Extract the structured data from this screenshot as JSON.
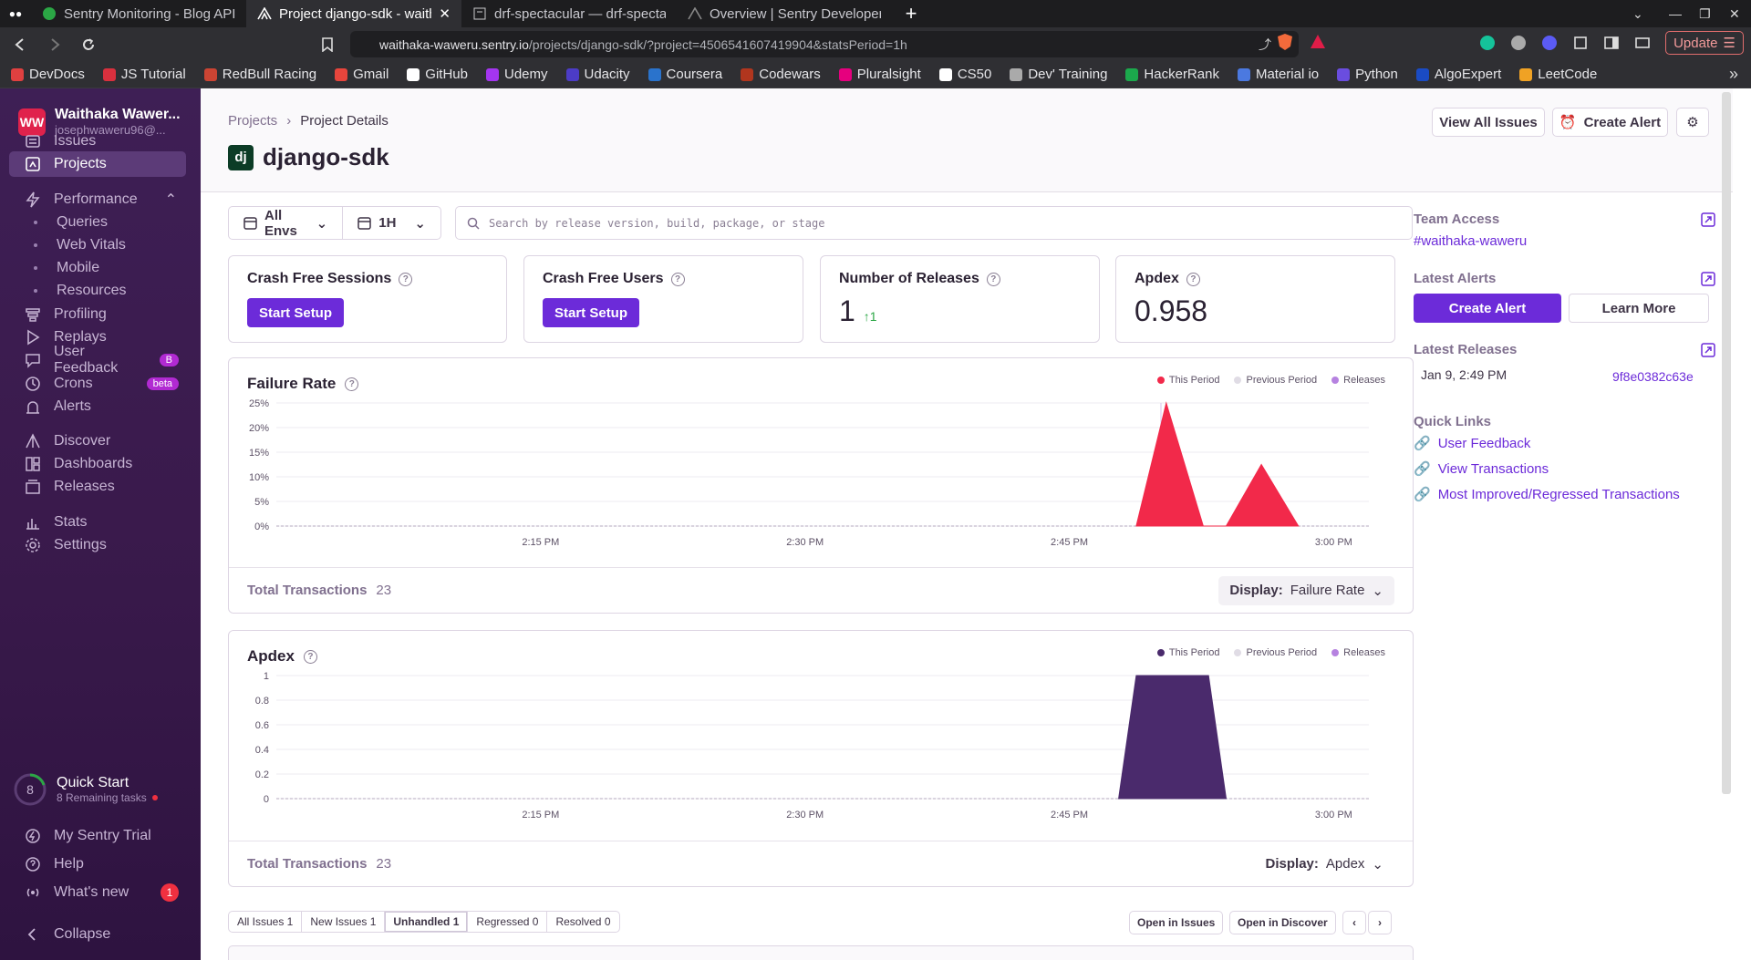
{
  "browser": {
    "tabs": [
      {
        "title": "Sentry Monitoring - Blog API",
        "active": false
      },
      {
        "title": "Project django-sdk - waithaka-waweru",
        "active": true
      },
      {
        "title": "drf-spectacular — drf-spectacular",
        "active": false
      },
      {
        "title": "Overview | Sentry Developer Docs",
        "active": false
      }
    ],
    "url_host": "waithaka-waweru.sentry.io",
    "url_path": "/projects/django-sdk/?project=4506541607419904&statsPeriod=1h",
    "update_label": "Update",
    "bookmarks": [
      "DevDocs",
      "JS Tutorial",
      "RedBull Racing",
      "Gmail",
      "GitHub",
      "Udemy",
      "Udacity",
      "Coursera",
      "Codewars",
      "Pluralsight",
      "CS50",
      "Dev' Training",
      "HackerRank",
      "Material io",
      "Python",
      "AlgoExpert",
      "LeetCode"
    ],
    "bookmark_colors": [
      "#e04040",
      "#d9303e",
      "#c43",
      "#e8453c",
      "#ffffff",
      "#a435f0",
      "#4c3cc6",
      "#2a73cc",
      "#b1361e",
      "#e6007e",
      "#fff",
      "#aaa",
      "#1ba94c",
      "#4b79e0",
      "#6a4ddf",
      "#1a4bc4",
      "#f0a224"
    ]
  },
  "sidebar": {
    "org_initials": "WW",
    "org_name": "Waithaka Wawer...",
    "org_email": "josephwaweru96@...",
    "items": [
      {
        "label": "Issues",
        "icon": "issues-icon"
      },
      {
        "label": "Projects",
        "icon": "projects-icon",
        "active": true
      },
      {
        "label": "Performance",
        "icon": "performance-icon"
      },
      {
        "label": "Queries",
        "sub": true
      },
      {
        "label": "Web Vitals",
        "sub": true
      },
      {
        "label": "Mobile",
        "sub": true
      },
      {
        "label": "Resources",
        "sub": true
      },
      {
        "label": "Profiling",
        "icon": "profiling-icon"
      },
      {
        "label": "Replays",
        "icon": "replays-icon"
      },
      {
        "label": "User Feedback",
        "icon": "user-feedback-icon",
        "badge": "B"
      },
      {
        "label": "Crons",
        "icon": "crons-icon",
        "badge": "beta"
      },
      {
        "label": "Alerts",
        "icon": "alerts-icon"
      },
      {
        "label": "Discover",
        "icon": "discover-icon"
      },
      {
        "label": "Dashboards",
        "icon": "dashboards-icon"
      },
      {
        "label": "Releases",
        "icon": "releases-icon"
      },
      {
        "label": "Stats",
        "icon": "stats-icon"
      },
      {
        "label": "Settings",
        "icon": "settings-icon"
      }
    ],
    "quickstart": {
      "count": "8",
      "title": "Quick Start",
      "subtitle": "8 Remaining tasks"
    },
    "footer": [
      {
        "label": "My Sentry Trial",
        "icon": "trial-icon"
      },
      {
        "label": "Help",
        "icon": "help-icon"
      },
      {
        "label": "What's new",
        "icon": "broadcast-icon",
        "badge": "1"
      },
      {
        "label": "Collapse",
        "icon": "collapse-icon"
      }
    ]
  },
  "header": {
    "breadcrumb_root": "Projects",
    "breadcrumb_current": "Project Details",
    "project_logo": "dj",
    "project_name": "django-sdk",
    "view_all_issues": "View All Issues",
    "create_alert": "Create Alert"
  },
  "filters": {
    "environment": "All Envs",
    "period": "1H",
    "search_placeholder": "Search by release version, build, package, or stage"
  },
  "cards": {
    "crash_free_sessions": {
      "title": "Crash Free Sessions",
      "button": "Start Setup"
    },
    "crash_free_users": {
      "title": "Crash Free Users",
      "button": "Start Setup"
    },
    "number_of_releases": {
      "title": "Number of Releases",
      "value": "1",
      "trend": "↑1"
    },
    "apdex": {
      "title": "Apdex",
      "value": "0.958"
    }
  },
  "legend": {
    "this_period": "This Period",
    "previous_period": "Previous Period",
    "releases": "Releases"
  },
  "failure_chart": {
    "title": "Failure Rate",
    "footer_label": "Total Transactions",
    "footer_value": "23",
    "display_label": "Display:",
    "display_value": "Failure Rate"
  },
  "apdex_chart": {
    "title": "Apdex",
    "footer_label": "Total Transactions",
    "footer_value": "23",
    "display_label": "Display:",
    "display_value": "Apdex"
  },
  "chart_data": [
    {
      "type": "area",
      "title": "Failure Rate",
      "x_ticks": [
        "2:15 PM",
        "2:30 PM",
        "2:45 PM",
        "3:00 PM"
      ],
      "y_ticks": [
        "25%",
        "20%",
        "15%",
        "10%",
        "5%",
        "0%"
      ],
      "ylim": [
        0,
        25
      ],
      "x_unit": "minutes after 2:00 PM",
      "xlim": [
        0,
        62
      ],
      "series": [
        {
          "name": "This Period",
          "color": "#f2294a",
          "points": [
            [
              48.8,
              0
            ],
            [
              50.5,
              25
            ],
            [
              52.6,
              0
            ],
            [
              53.9,
              0
            ],
            [
              55.9,
              12.5
            ],
            [
              58,
              0
            ]
          ]
        }
      ],
      "release_x": 50.2
    },
    {
      "type": "area",
      "title": "Apdex",
      "x_ticks": [
        "2:15 PM",
        "2:30 PM",
        "2:45 PM",
        "3:00 PM"
      ],
      "y_ticks": [
        "1",
        "0.8",
        "0.6",
        "0.4",
        "0.2",
        "0"
      ],
      "ylim": [
        0,
        1
      ],
      "x_unit": "minutes after 2:00 PM",
      "xlim": [
        0,
        62
      ],
      "series": [
        {
          "name": "This Period",
          "color": "#4a2a6c",
          "points": [
            [
              47.8,
              0
            ],
            [
              48.8,
              1
            ],
            [
              52.9,
              1
            ],
            [
              53.9,
              0
            ]
          ]
        }
      ]
    }
  ],
  "right": {
    "team_access_title": "Team Access",
    "team_access_value": "#waithaka-waweru",
    "latest_alerts_title": "Latest Alerts",
    "create_alert": "Create Alert",
    "learn_more": "Learn More",
    "latest_releases_title": "Latest Releases",
    "release_date": "Jan 9, 2:49 PM",
    "release_version": "9f8e0382c63e",
    "quick_links_title": "Quick Links",
    "quick_links": [
      "User Feedback",
      "View Transactions",
      "Most Improved/Regressed Transactions"
    ]
  },
  "issues": {
    "tabs": [
      "All Issues 1",
      "New Issues 1",
      "Unhandled 1",
      "Regressed 0",
      "Resolved 0"
    ],
    "open_in_issues": "Open in Issues",
    "open_in_discover": "Open in Discover"
  }
}
